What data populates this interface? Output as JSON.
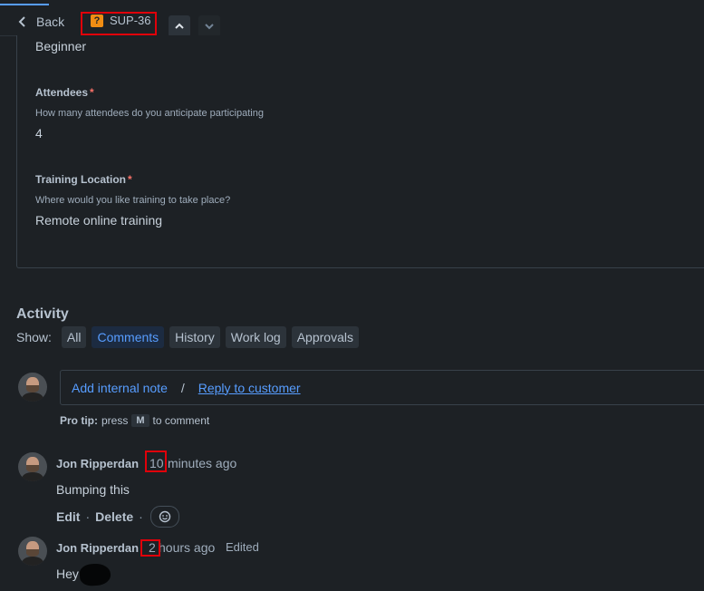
{
  "topbar": {
    "back_label": "Back",
    "issue_key": "SUP-36",
    "issue_type_icon": "question-icon"
  },
  "fields": {
    "level_value": "Beginner",
    "attendees": {
      "label": "Attendees",
      "required_mark": "*",
      "description": "How many attendees do you anticipate participating",
      "value": "4"
    },
    "location": {
      "label": "Training Location",
      "required_mark": "*",
      "description": "Where would you like training to take place?",
      "value": "Remote online training"
    }
  },
  "activity": {
    "title": "Activity",
    "show_label": "Show:",
    "filters": [
      "All",
      "Comments",
      "History",
      "Work log",
      "Approvals"
    ],
    "active_filter": "Comments",
    "add_internal_note": "Add internal note",
    "separator": "/",
    "reply_to_customer": "Reply to customer",
    "protip_prefix": "Pro tip:",
    "protip_press": "press",
    "protip_key": "M",
    "protip_suffix": "to comment"
  },
  "comments": [
    {
      "author": "Jon Ripperdan",
      "time_number": "10",
      "time_unit": "minutes ago",
      "body": "Bumping this",
      "actions": [
        "Edit",
        "Delete"
      ],
      "action_separator": "·"
    },
    {
      "author": "Jon Ripperdan",
      "time_number": "2",
      "time_unit": "hours ago",
      "edited_label": "Edited",
      "body": "Hey"
    }
  ],
  "colors": {
    "background": "#1d2125",
    "link": "#579dff",
    "highlight_box": "#e0000a",
    "required": "#f87168"
  }
}
